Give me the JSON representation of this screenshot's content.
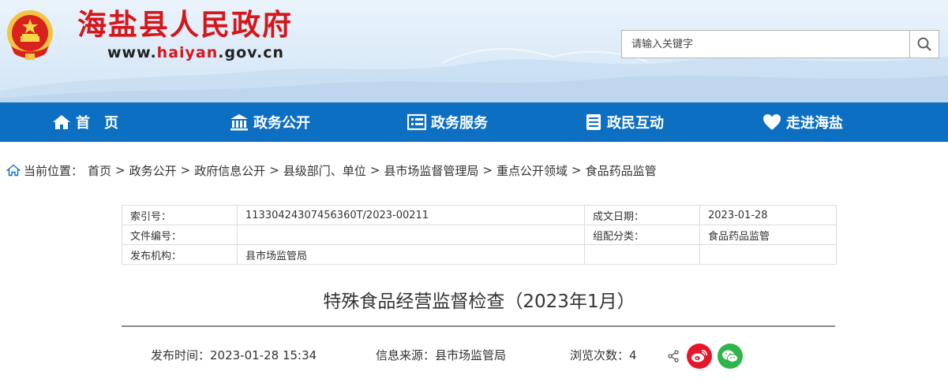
{
  "header": {
    "site_name": "海盐县人民政府",
    "url_prefix": "www.",
    "url_highlight": "haiyan",
    "url_suffix": ".gov.cn",
    "search_placeholder": "请输入关键字"
  },
  "nav": {
    "items": [
      {
        "label": "首　页",
        "icon": "home-icon"
      },
      {
        "label": "政务公开",
        "icon": "building-icon"
      },
      {
        "label": "政务服务",
        "icon": "list-icon"
      },
      {
        "label": "政民互动",
        "icon": "document-icon"
      },
      {
        "label": "走进海盐",
        "icon": "heart-icon"
      }
    ],
    "bg_color": "#0d6fc2"
  },
  "breadcrumb": {
    "prefix": "当前位置：",
    "items": [
      "首页",
      "政务公开",
      "政府信息公开",
      "县级部门、单位",
      "县市场监督管理局",
      "重点公开领域",
      "食品药品监管"
    ],
    "separator": ">"
  },
  "meta": {
    "rows": [
      {
        "k1": "索引号：",
        "v1": "11330424307456360T/2023-00211",
        "k2": "成文日期：",
        "v2": "2023-01-28"
      },
      {
        "k1": "文件编号：",
        "v1": "",
        "k2": "组配分类：",
        "v2": "食品药品监管"
      },
      {
        "k1": "发布机构：",
        "v1": "县市场监管局",
        "k2": "",
        "v2": ""
      }
    ]
  },
  "article": {
    "title": "特殊食品经营监督检查（2023年1月）",
    "publish_time": "发布时间：2023-01-28 15:34",
    "source": "信息来源：县市场监管局",
    "views": "浏览次数：4"
  },
  "colors": {
    "brand_red": "#d6161b",
    "nav_blue": "#0d6fc2",
    "weibo_red": "#e6162d",
    "wechat_green": "#2fb54a"
  }
}
